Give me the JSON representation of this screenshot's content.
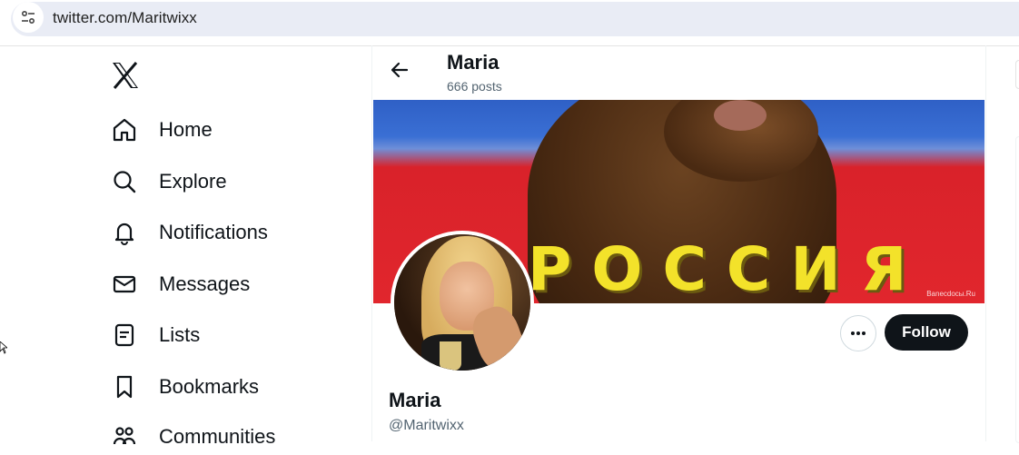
{
  "browser": {
    "url": "twitter.com/Maritwixx"
  },
  "sidebar": {
    "logo_icon": "x-logo-icon",
    "items": [
      {
        "label": "Home",
        "icon": "home-icon"
      },
      {
        "label": "Explore",
        "icon": "search-icon"
      },
      {
        "label": "Notifications",
        "icon": "bell-icon"
      },
      {
        "label": "Messages",
        "icon": "mail-icon"
      },
      {
        "label": "Lists",
        "icon": "list-icon"
      },
      {
        "label": "Bookmarks",
        "icon": "bookmark-icon"
      },
      {
        "label": "Communities",
        "icon": "communities-icon"
      }
    ]
  },
  "header": {
    "name": "Maria",
    "posts": "666 posts"
  },
  "banner": {
    "text": "РОССИЯ",
    "watermark": "Banecdoсы.Ru"
  },
  "profile": {
    "name": "Maria",
    "handle": "@Maritwixx",
    "follow_label": "Follow"
  },
  "colors": {
    "text": "#0f1419",
    "secondary": "#536471",
    "follow_bg": "#0f1419",
    "url_bar": "#e9ecf5"
  }
}
